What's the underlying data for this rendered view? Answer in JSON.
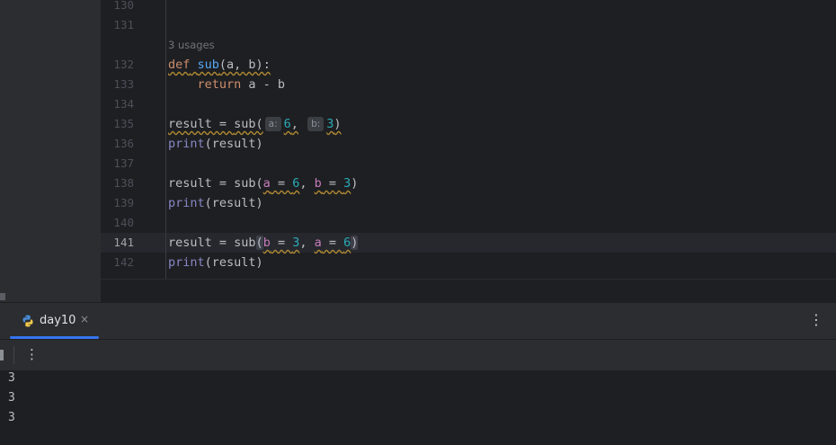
{
  "editor": {
    "usages_hint": "3 usages",
    "line_numbers": [
      "130",
      "131",
      "132",
      "133",
      "134",
      "135",
      "136",
      "137",
      "138",
      "139",
      "140",
      "141",
      "142"
    ],
    "current_line": "141",
    "tokens": {
      "def_kw": "def",
      "sub_name": "sub",
      "def_params": "(a, b):",
      "return_kw": "return",
      "return_expr": " a - b",
      "result_assign": "result = ",
      "sub_call": "sub(",
      "print_fn": "print",
      "print_arg": "(result)",
      "hint_a": "a:",
      "hint_b": "b:",
      "num_6": "6",
      "num_3": "3",
      "comma": ",",
      "close_paren": ")",
      "open_paren": "(",
      "param_a": "a",
      "param_b": "b",
      "eq": " = ",
      "comma_sp": ", "
    }
  },
  "run_panel": {
    "tab_label": "day10",
    "tab_close": "×",
    "more_options": "⋮",
    "toolbar_more": "⋮",
    "output_lines": [
      "3",
      "3",
      "3"
    ]
  },
  "colors": {
    "keyword": "#cf8e6d",
    "function": "#56a8f5",
    "builtin": "#8888c6",
    "number": "#2aacb8",
    "parameter": "#c77dbb",
    "accent": "#3574f0"
  },
  "icons": {
    "tab_icon": "python-icon"
  }
}
